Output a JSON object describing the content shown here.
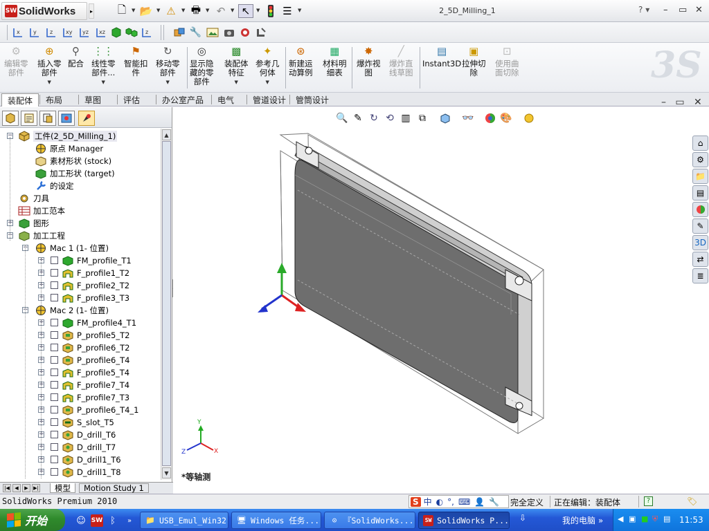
{
  "app": {
    "title_brand": "SolidWorks",
    "document_title": "2_5D_Milling_1"
  },
  "window_controls": {
    "help": "?",
    "minimize": "–",
    "restore": "▭",
    "close": "✕"
  },
  "ribbon": {
    "buttons": [
      {
        "label": "编辑零\n部件",
        "disabled": true,
        "icon": "edit-component-icon"
      },
      {
        "label": "插入零\n部件",
        "disabled": false,
        "icon": "insert-component-icon"
      },
      {
        "label": "配合",
        "disabled": false,
        "icon": "mate-icon"
      },
      {
        "label": "线性零\n部件...",
        "disabled": false,
        "icon": "linear-pattern-icon"
      },
      {
        "label": "智能扣\n件",
        "disabled": false,
        "icon": "smart-fasteners-icon"
      },
      {
        "label": "移动零\n部件",
        "disabled": false,
        "icon": "move-component-icon"
      },
      {
        "label": "显示隐\n藏的零\n部件",
        "disabled": false,
        "icon": "show-hidden-icon"
      },
      {
        "label": "装配体\n特征",
        "disabled": false,
        "icon": "assembly-features-icon"
      },
      {
        "label": "参考几\n何体",
        "disabled": false,
        "icon": "reference-geometry-icon"
      },
      {
        "label": "新建运\n动算例",
        "disabled": false,
        "icon": "new-motion-study-icon"
      },
      {
        "label": "材料明\n细表",
        "disabled": false,
        "icon": "bom-icon"
      },
      {
        "label": "爆炸视\n图",
        "disabled": false,
        "icon": "exploded-view-icon"
      },
      {
        "label": "爆炸直\n线草图",
        "disabled": true,
        "icon": "explode-line-sketch-icon"
      },
      {
        "label": "Instant3D",
        "disabled": false,
        "icon": "instant3d-icon"
      },
      {
        "label": "拉伸切\n除",
        "disabled": false,
        "icon": "extruded-cut-icon"
      },
      {
        "label": "使用曲\n面切除",
        "disabled": true,
        "icon": "surface-cut-icon"
      }
    ]
  },
  "tabs": [
    "装配体",
    "布局",
    "草图",
    "评估",
    "办公室产品",
    "电气",
    "管道设计",
    "管筒设计"
  ],
  "tree": [
    {
      "label": "工件(2_5D_Milling_1)",
      "icon": "assembly-icon"
    },
    {
      "label": "原点 Manager",
      "icon": "origin-icon"
    },
    {
      "label": "素材形状 (stock)",
      "icon": "stock-icon"
    },
    {
      "label": "加工形状 (target)",
      "icon": "target-icon"
    },
    {
      "label": "的设定",
      "icon": "wrench-icon"
    },
    {
      "label": "刀具",
      "icon": "tool-gear-icon"
    },
    {
      "label": "加工范本",
      "icon": "template-icon"
    },
    {
      "label": "图形",
      "icon": "shape-icon"
    },
    {
      "label": "加工工程",
      "icon": "process-icon"
    },
    {
      "label": "Mac 1 (1- 位置)",
      "icon": "mac-icon"
    },
    {
      "label": "FM_profile_T1",
      "icon": "feature-green-icon"
    },
    {
      "label": "F_profile1_T2",
      "icon": "feature-yellow-icon"
    },
    {
      "label": "F_profile2_T2",
      "icon": "feature-yellow-icon"
    },
    {
      "label": "F_profile3_T3",
      "icon": "feature-yellow-icon"
    },
    {
      "label": "Mac 2 (1- 位置)",
      "icon": "mac-icon"
    },
    {
      "label": "FM_profile4_T1",
      "icon": "feature-green-icon"
    },
    {
      "label": "P_profile5_T2",
      "icon": "feature-box-icon"
    },
    {
      "label": "P_profile6_T2",
      "icon": "feature-box-icon"
    },
    {
      "label": "P_profile6_T4",
      "icon": "feature-box-icon"
    },
    {
      "label": "F_profile5_T4",
      "icon": "feature-yellow-icon"
    },
    {
      "label": "F_profile7_T4",
      "icon": "feature-yellow-icon"
    },
    {
      "label": "F_profile7_T3",
      "icon": "feature-yellow-icon"
    },
    {
      "label": "P_profile6_T4_1",
      "icon": "feature-box-icon"
    },
    {
      "label": "S_slot_T5",
      "icon": "feature-slot-icon"
    },
    {
      "label": "D_drill_T6",
      "icon": "feature-drill-icon"
    },
    {
      "label": "D_drill_T7",
      "icon": "feature-drill-icon"
    },
    {
      "label": "D_drill1_T6",
      "icon": "feature-drill-icon"
    },
    {
      "label": "D_drill1_T8",
      "icon": "feature-drill-icon"
    }
  ],
  "bottom_tabs": {
    "model": "模型",
    "motion": "Motion Study 1"
  },
  "viewport": {
    "view_name": "*等轴测",
    "axis_x": "X",
    "axis_y": "Y",
    "axis_z": "Z"
  },
  "status": {
    "product": "SolidWorks Premium 2010",
    "definition": "完全定义",
    "editing": "正在编辑：装配体",
    "help": "?"
  },
  "ime": {
    "logo": "S",
    "mode": "中"
  },
  "taskbar": {
    "start": "开始",
    "tasks": [
      "USB_Emul_Win32",
      "Windows 任务...",
      "『SolidWorks...",
      "SolidWorks P..."
    ],
    "my_computer": "我的电脑",
    "clock": "11:53"
  },
  "colors": {
    "accent": "#2458d6",
    "brand_red": "#c8201a",
    "start_green": "#2f8a2c"
  }
}
